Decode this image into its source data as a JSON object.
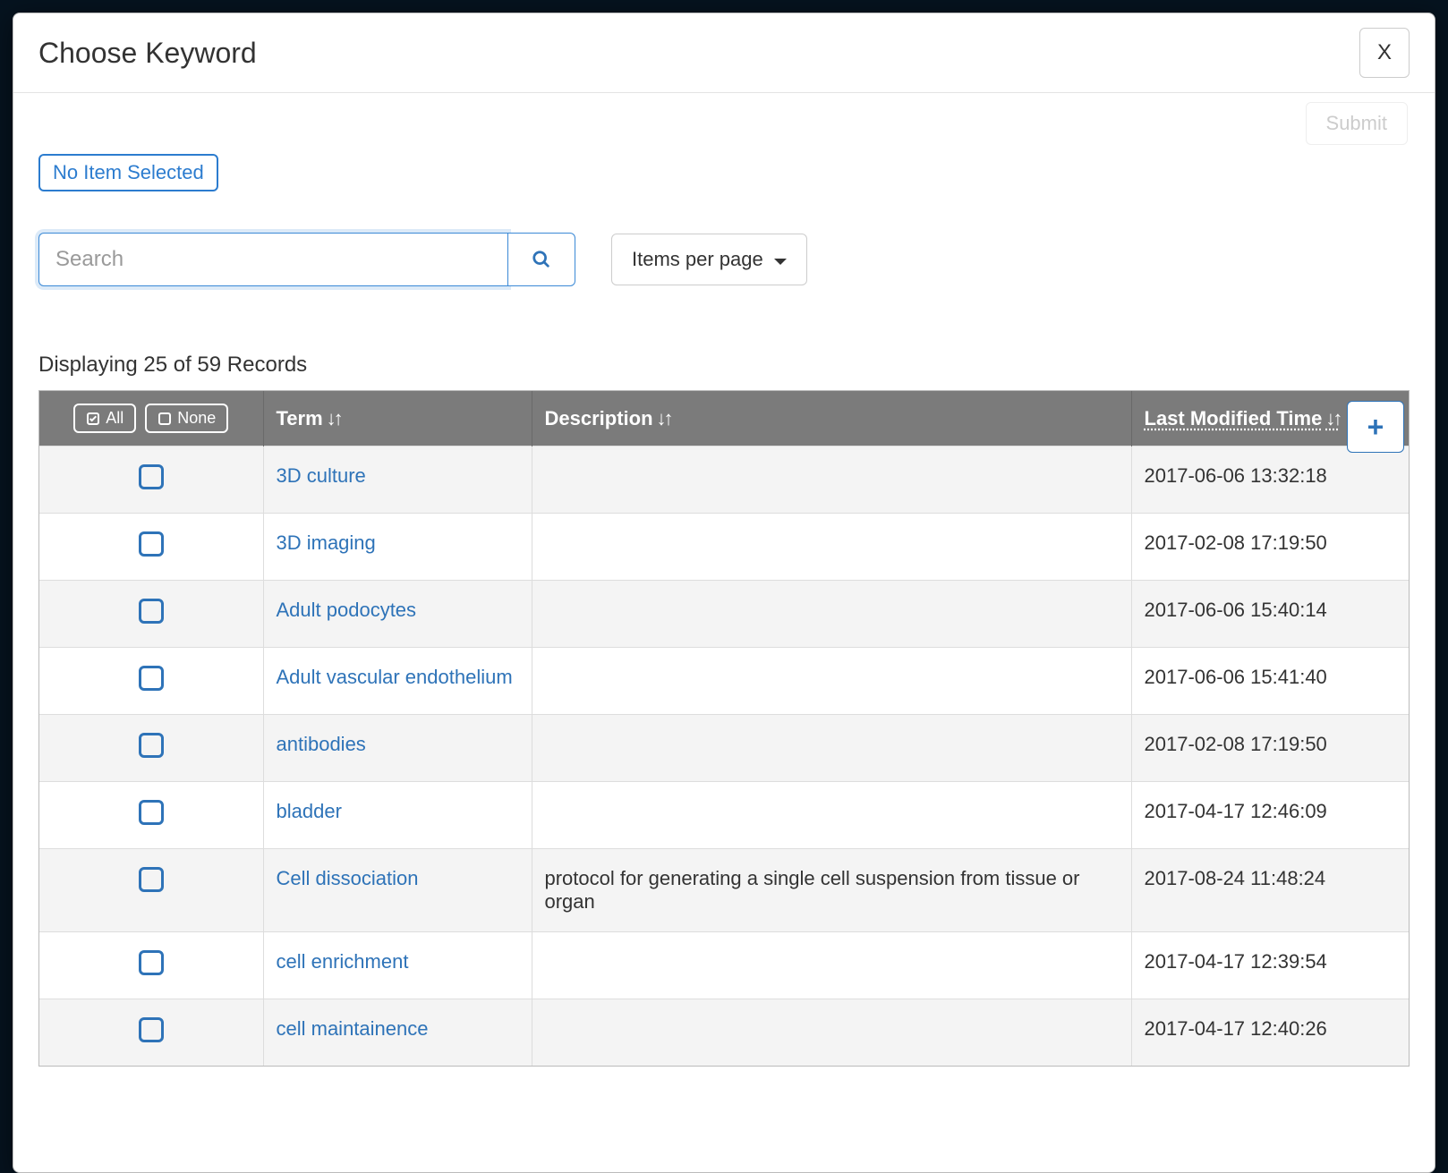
{
  "modal": {
    "title": "Choose Keyword",
    "close_label": "X",
    "submit_label": "Submit",
    "selection_pill": "No Item Selected"
  },
  "search": {
    "placeholder": "Search",
    "value": ""
  },
  "items_per_page_label": "Items per page",
  "add_label": "+",
  "records_count_text": "Displaying 25 of 59 Records",
  "table": {
    "select_all_label": "All",
    "select_none_label": "None",
    "headers": {
      "term": "Term",
      "description": "Description",
      "last_modified": "Last Modified Time"
    },
    "sorted_column": "last_modified",
    "rows": [
      {
        "term": "3D culture",
        "description": "",
        "last_modified": "2017-06-06 13:32:18"
      },
      {
        "term": "3D imaging",
        "description": "",
        "last_modified": "2017-02-08 17:19:50"
      },
      {
        "term": "Adult podocytes",
        "description": "",
        "last_modified": "2017-06-06 15:40:14"
      },
      {
        "term": "Adult vascular endothelium",
        "description": "",
        "last_modified": "2017-06-06 15:41:40"
      },
      {
        "term": "antibodies",
        "description": "",
        "last_modified": "2017-02-08 17:19:50"
      },
      {
        "term": "bladder",
        "description": "",
        "last_modified": "2017-04-17 12:46:09"
      },
      {
        "term": "Cell dissociation",
        "description": "protocol for generating a single cell suspension from tissue or organ",
        "last_modified": "2017-08-24 11:48:24"
      },
      {
        "term": "cell enrichment",
        "description": "",
        "last_modified": "2017-04-17 12:39:54"
      },
      {
        "term": "cell maintainence",
        "description": "",
        "last_modified": "2017-04-17 12:40:26"
      }
    ]
  }
}
